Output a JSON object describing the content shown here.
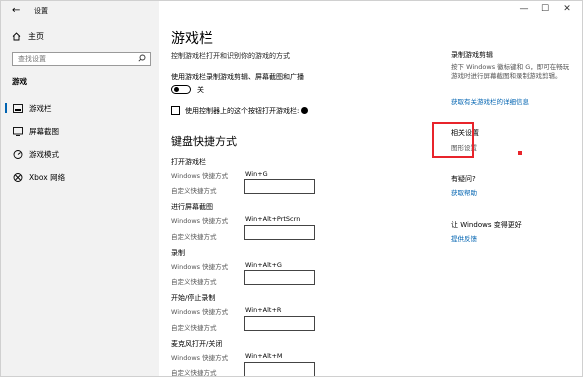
{
  "titlebar": {
    "back": "←",
    "title": "设置",
    "minimize": "—",
    "maximize": "☐",
    "close": "✕"
  },
  "sidebar": {
    "home": "主页",
    "search_placeholder": "查找设置",
    "section": "游戏",
    "items": [
      {
        "label": "游戏栏",
        "icon": "game-bar-icon",
        "active": true
      },
      {
        "label": "屏幕截图",
        "icon": "screenshot-icon",
        "active": false
      },
      {
        "label": "游戏模式",
        "icon": "game-mode-icon",
        "active": false
      },
      {
        "label": "Xbox 网络",
        "icon": "xbox-icon",
        "active": false
      }
    ]
  },
  "main": {
    "title": "游戏栏",
    "description": "控制游戏栏打开和识别你的游戏的方式",
    "record_caption": "使用游戏栏录制游戏剪辑、屏幕截图和广播",
    "toggle_state": "关",
    "checkbox_label": "使用控制器上的这个按钮打开游戏栏:",
    "shortcuts_title": "键盘快捷方式",
    "windows_label": "Windows 快捷方式",
    "custom_label": "自定义快捷方式",
    "groups": [
      {
        "title": "打开游戏栏",
        "windows": "Win+G",
        "custom": ""
      },
      {
        "title": "进行屏幕截图",
        "windows": "Win+Alt+PrtScrn",
        "custom": ""
      },
      {
        "title": "录制",
        "windows": "Win+Alt+G",
        "custom": ""
      },
      {
        "title": "开始/停止录制",
        "windows": "Win+Alt+R",
        "custom": ""
      },
      {
        "title": "麦克风打开/关闭",
        "windows": "Win+Alt+M",
        "custom": ""
      }
    ]
  },
  "right": {
    "clip_title": "录制游戏剪辑",
    "clip_text": "按下 Windows 徽标键和 G，即可在畅玩游戏时进行屏幕截图和录制游戏剪辑。",
    "clip_link": "获取有关游戏栏的详细信息",
    "related_title": "相关设置",
    "related_link": "图形设置",
    "question_title": "有疑问?",
    "help_link": "获取帮助",
    "improve_title": "让 Windows 变得更好",
    "feedback_link": "提供反馈"
  },
  "colors": {
    "accent": "#0063b1",
    "highlight": "#e8242b",
    "sidebar_bg": "#f2f2f2"
  }
}
